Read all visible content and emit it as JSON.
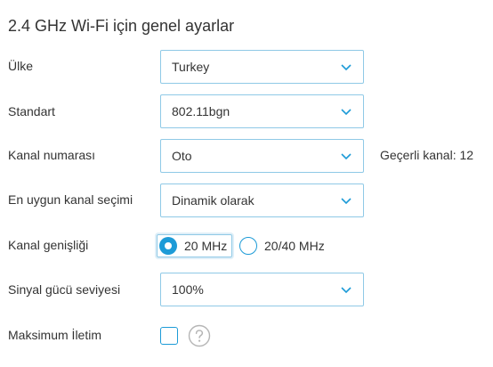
{
  "title": "2.4 GHz Wi-Fi için genel ayarlar",
  "country": {
    "label": "Ülke",
    "value": "Turkey"
  },
  "standard": {
    "label": "Standart",
    "value": "802.11bgn"
  },
  "channel": {
    "label": "Kanal numarası",
    "value": "Oto",
    "current": "Geçerli kanal: 12"
  },
  "optimal_channel": {
    "label": "En uygun kanal seçimi",
    "value": "Dinamik olarak"
  },
  "bandwidth": {
    "label": "Kanal genişliği",
    "options": [
      "20 MHz",
      "20/40 MHz"
    ],
    "selected": "20 MHz"
  },
  "signal_strength": {
    "label": "Sinyal gücü seviyesi",
    "value": "100%"
  },
  "max_transmission": {
    "label": "Maksimum İletim",
    "checked": false
  },
  "icons": {
    "dropdown": "chevron-down-icon",
    "help": "question-mark-icon"
  },
  "colors": {
    "accent": "#1d9bd7",
    "border": "#8fc9e6",
    "text": "#333333"
  }
}
